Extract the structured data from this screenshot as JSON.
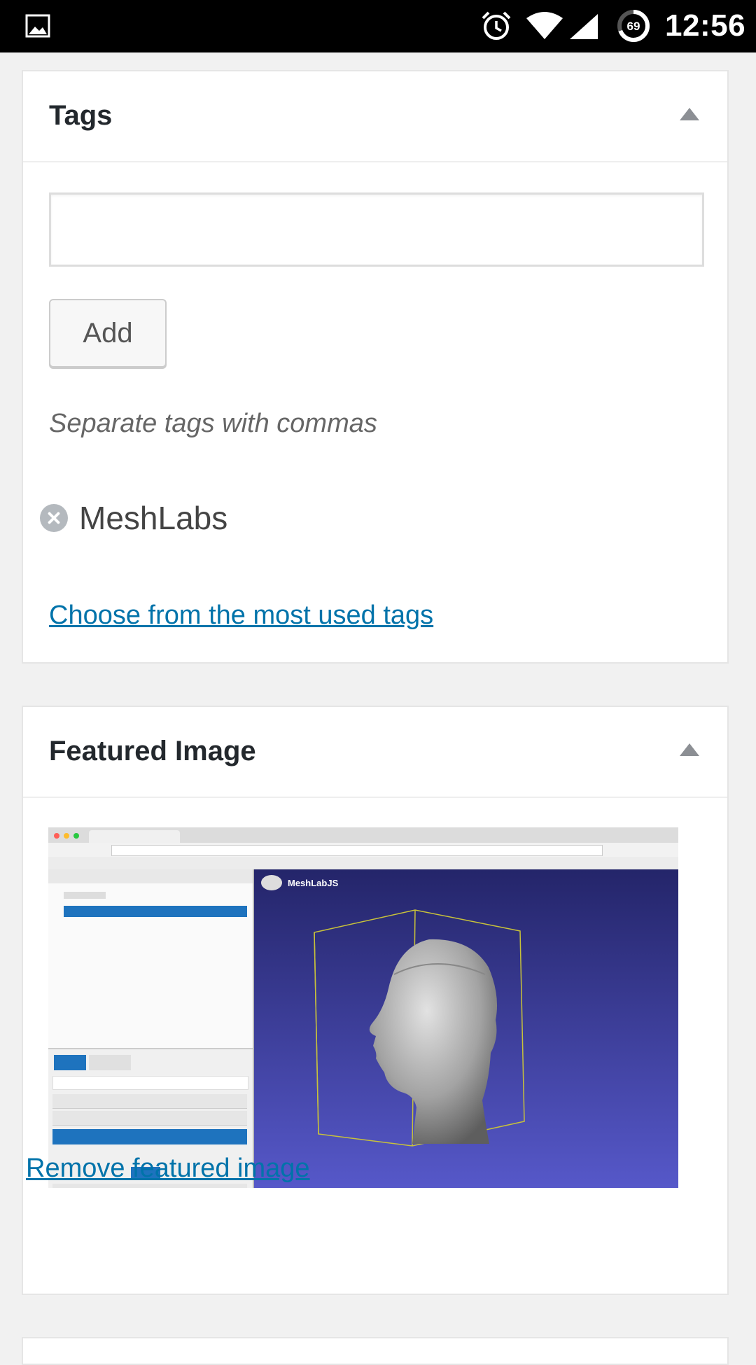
{
  "status_bar": {
    "time": "12:56",
    "battery_level": "69",
    "icons": [
      "gallery-icon",
      "alarm-icon",
      "wifi-icon",
      "signal-icon",
      "battery-icon"
    ]
  },
  "tags_box": {
    "title": "Tags",
    "input_value": "",
    "add_label": "Add",
    "hint": "Separate tags with commas",
    "tags": [
      "MeshLabs"
    ],
    "most_used_link": "Choose from the most used tags"
  },
  "featured_box": {
    "title": "Featured Image",
    "image_brand_text": "MeshLabJS",
    "remove_link": "Remove featured image"
  },
  "colors": {
    "link": "#0073aa",
    "background": "#f1f1f1",
    "status_bar": "#000000"
  }
}
